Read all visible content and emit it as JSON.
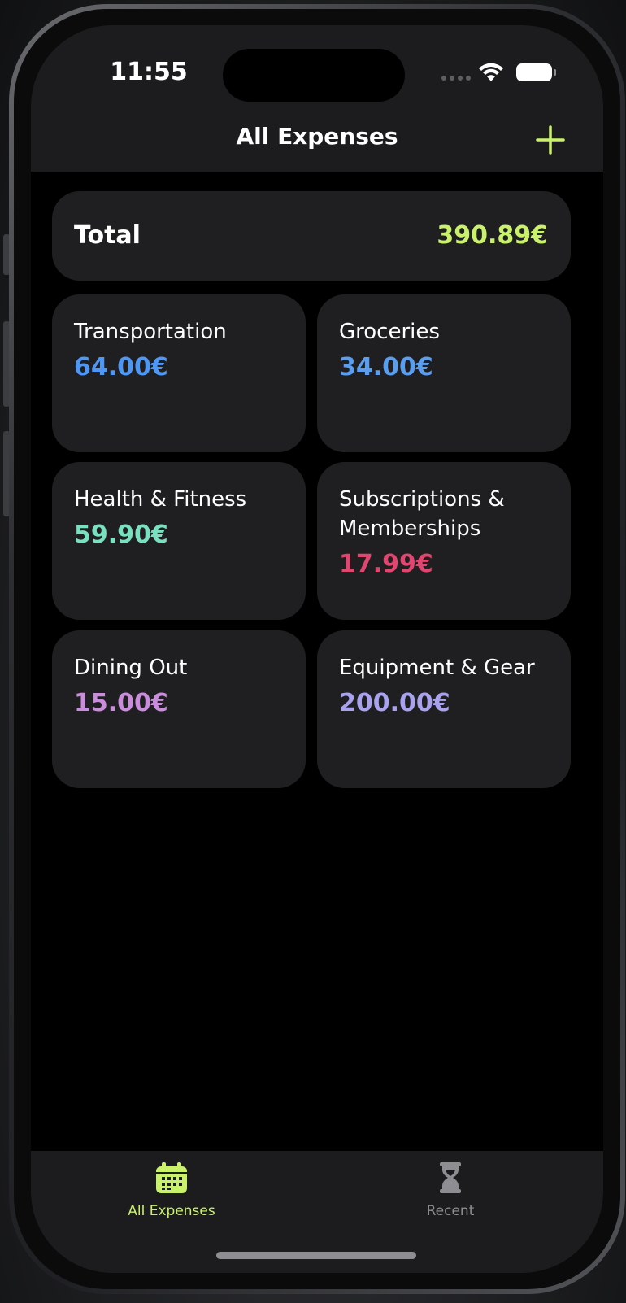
{
  "status_bar": {
    "time": "11:55",
    "icons": [
      "signal-icon",
      "wifi-icon",
      "battery-icon"
    ]
  },
  "nav": {
    "title": "All Expenses",
    "add_icon": "plus-icon",
    "accent": "#c9f26a"
  },
  "total": {
    "label": "Total",
    "value": "390.89€"
  },
  "categories": [
    {
      "name": "Transportation",
      "value": "64.00€",
      "color": "#4f97f5"
    },
    {
      "name": "Groceries",
      "value": "34.00€",
      "color": "#5a9ef0"
    },
    {
      "name": "Health & Fitness",
      "value": "59.90€",
      "color": "#79e0c0"
    },
    {
      "name": "Subscriptions & Memberships",
      "value": "17.99€",
      "color": "#e0466f"
    },
    {
      "name": "Dining Out",
      "value": "15.00€",
      "color": "#c98ddb"
    },
    {
      "name": "Equipment & Gear",
      "value": "200.00€",
      "color": "#a9a3ef"
    }
  ],
  "tabs": [
    {
      "label": "All Expenses",
      "icon": "calendar-icon",
      "selected": true,
      "color": "#c9f26a"
    },
    {
      "label": "Recent",
      "icon": "hourglass-icon",
      "selected": false,
      "color": "#8e8e92"
    }
  ]
}
